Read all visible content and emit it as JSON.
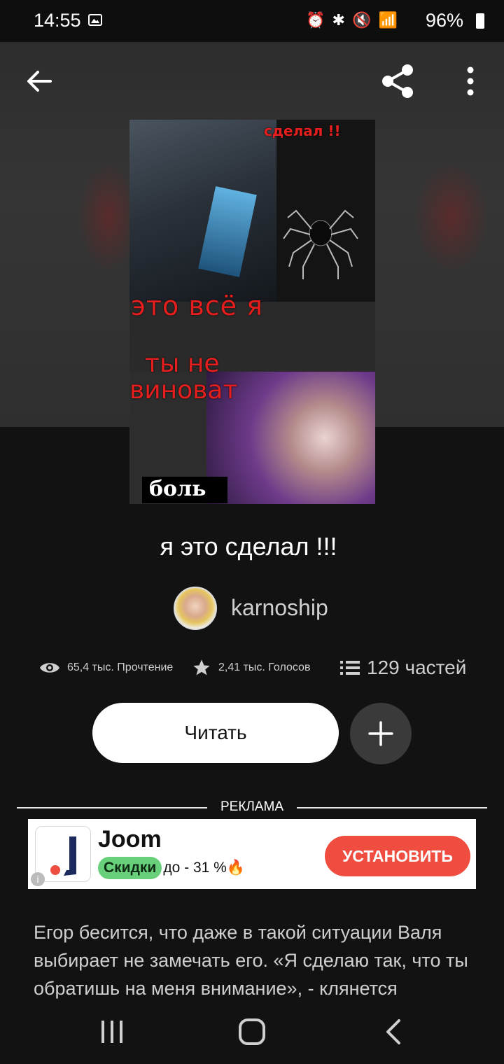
{
  "status_bar": {
    "time": "14:55",
    "icons": "⏰ ✱ 🔇 📶",
    "battery": "96%"
  },
  "cover": {
    "texts": [
      "сделал !!",
      "это всё я",
      "ты не",
      "виноват",
      "боль"
    ]
  },
  "story": {
    "title": "я это сделал !!!",
    "author": "karnoship"
  },
  "stats": {
    "reads": "65,4 тыс. Прочтение",
    "votes": "2,41 тыс. Голосов",
    "parts": "129 частей"
  },
  "actions": {
    "read_label": "Читать",
    "add_label": "+"
  },
  "ad": {
    "label": "РЕКЛАМА",
    "brand": "Joom",
    "sale_pill": "Скидки",
    "sale_text": "до - 31 %🔥",
    "install_label": "УСТАНОВИТЬ",
    "info_icon": "i",
    "brand_color": "#ee4d3f"
  },
  "description": "Егор бесится, что даже в такой ситуации Валя выбирает не замечать его. «Я сделаю так, что ты обратишь на меня внимание», - клянется"
}
